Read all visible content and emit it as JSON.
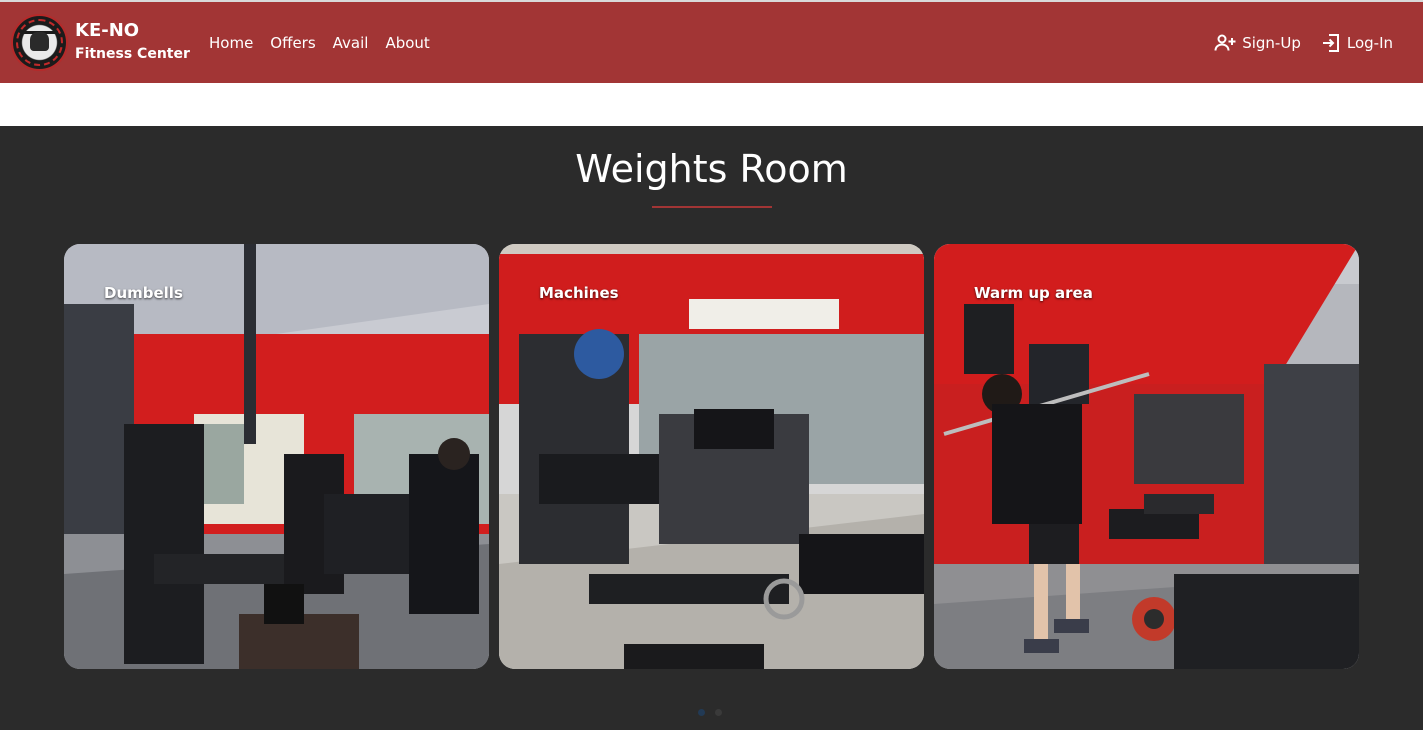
{
  "nav": {
    "brand_title": "KE-NO",
    "brand_subtitle": "Fitness Center",
    "links": [
      {
        "label": "Home"
      },
      {
        "label": "Offers"
      },
      {
        "label": "Avail"
      },
      {
        "label": "About"
      }
    ],
    "signup_label": "Sign-Up",
    "login_label": "Log-In",
    "signup_icon": "user-plus-icon",
    "login_icon": "login-icon",
    "accent_color": "#a23535"
  },
  "section": {
    "title": "Weights Room",
    "cards": [
      {
        "label": "Dumbells"
      },
      {
        "label": "Machines"
      },
      {
        "label": "Warm up area"
      }
    ],
    "carousel": {
      "active_index": 0,
      "count": 2
    }
  }
}
